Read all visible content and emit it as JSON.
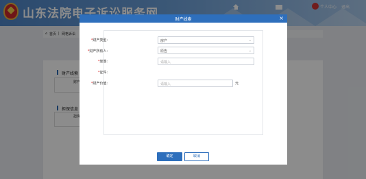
{
  "header": {
    "site_title": "山东法院电子诉讼服务网",
    "user_center": "个人中心",
    "logout": "退出"
  },
  "breadcrumb": {
    "home": "首页",
    "current": "网格诉讼"
  },
  "background": {
    "section1_title": "财产线索",
    "section1_cell": "财产",
    "section2_title": "担保信息",
    "section2_cell": "担保"
  },
  "modal": {
    "title": "财产线索",
    "close": "×",
    "fields": {
      "asset_type": {
        "label": "财产类型:",
        "value": "房产"
      },
      "owner": {
        "label": "财产所有人:",
        "value": "原告"
      },
      "location": {
        "label": "坐落:",
        "placeholder": "请输入"
      },
      "certificate": {
        "label": "证件:"
      },
      "value": {
        "label": "财产价值:",
        "placeholder": "请输入",
        "unit": "元"
      }
    },
    "confirm": "确定",
    "cancel": "取消"
  },
  "colors": {
    "primary": "#2e6fbc",
    "required": "#e02020"
  }
}
